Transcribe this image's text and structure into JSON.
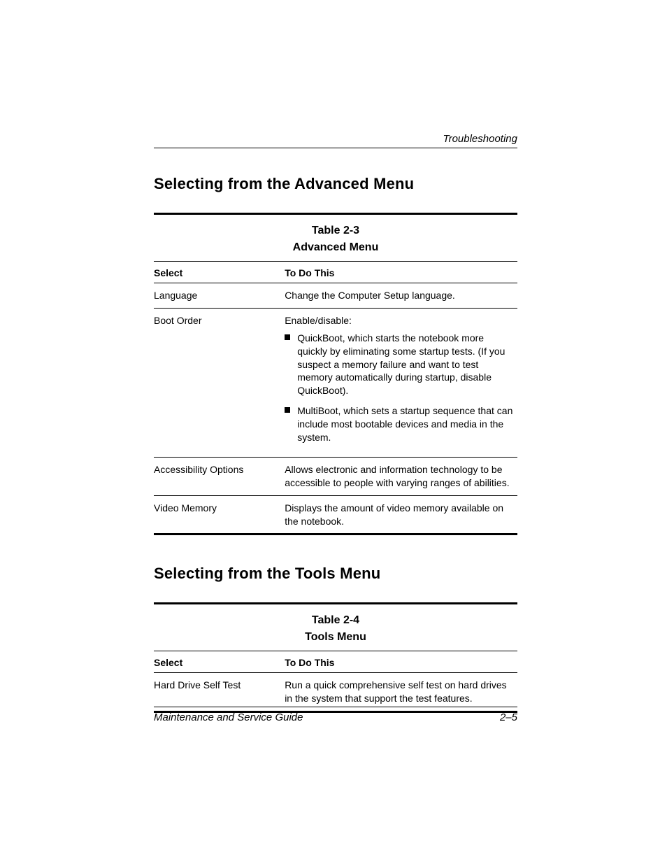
{
  "header": {
    "running": "Troubleshooting"
  },
  "section1": {
    "title": "Selecting from the Advanced Menu",
    "table_label": "Table 2-3",
    "table_title": "Advanced Menu",
    "col_select": "Select",
    "col_todo": "To Do This",
    "rows": [
      {
        "select": "Language",
        "todo": "Change the Computer Setup language."
      },
      {
        "select": "Boot Order",
        "todo_intro": "Enable/disable:",
        "bullets": [
          "QuickBoot, which starts the notebook more quickly by eliminating some startup tests. (If you suspect a memory failure and want to test memory automatically during startup, disable QuickBoot).",
          "MultiBoot, which sets a startup sequence that can include most bootable devices and media in the system."
        ]
      },
      {
        "select": "Accessibility Options",
        "todo": "Allows electronic and information technology to be accessible to people with varying ranges of abilities."
      },
      {
        "select": "Video Memory",
        "todo": "Displays the amount of video memory available on the notebook."
      }
    ]
  },
  "section2": {
    "title": "Selecting from the Tools Menu",
    "table_label": "Table 2-4",
    "table_title": "Tools Menu",
    "col_select": "Select",
    "col_todo": "To Do This",
    "rows": [
      {
        "select": "Hard Drive Self Test",
        "todo": "Run a quick comprehensive self test on hard drives in the system that support the test features."
      }
    ]
  },
  "footer": {
    "left": "Maintenance and Service Guide",
    "right": "2–5"
  }
}
